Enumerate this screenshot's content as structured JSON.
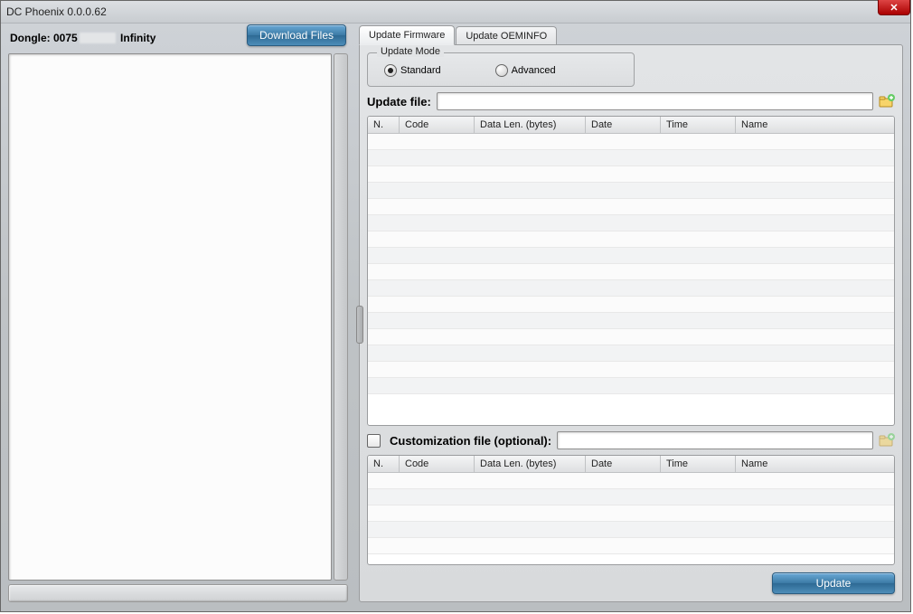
{
  "window": {
    "title": "DC Phoenix 0.0.0.62"
  },
  "dongle": {
    "label_prefix": "Dongle: 0075",
    "label_suffix": " Infinity"
  },
  "buttons": {
    "download_files": "Download Files",
    "update": "Update"
  },
  "tabs": {
    "firmware": "Update Firmware",
    "oeminfo": "Update OEMINFO"
  },
  "update_mode": {
    "legend": "Update Mode",
    "standard": "Standard",
    "advanced": "Advanced",
    "selected": "standard"
  },
  "update_file": {
    "label": "Update file:",
    "value": ""
  },
  "custom_file": {
    "label": "Customization file (optional):",
    "value": ""
  },
  "columns": {
    "n": "N.",
    "code": "Code",
    "data_len": "Data Len. (bytes)",
    "date": "Date",
    "time": "Time",
    "name": "Name"
  },
  "log": {
    "text": ""
  }
}
